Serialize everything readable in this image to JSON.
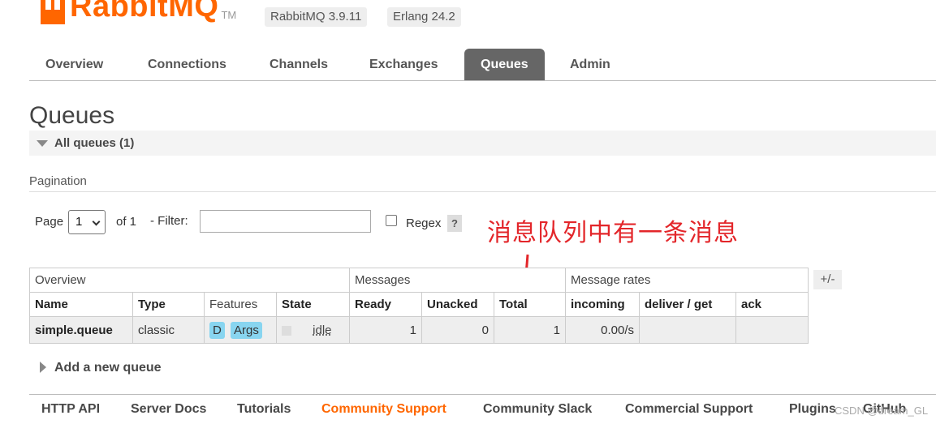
{
  "header": {
    "logo_text": "RabbitMQ",
    "logo_tm": "TM",
    "version": "RabbitMQ 3.9.11",
    "erlang": "Erlang 24.2"
  },
  "tabs": [
    {
      "label": "Overview"
    },
    {
      "label": "Connections"
    },
    {
      "label": "Channels"
    },
    {
      "label": "Exchanges"
    },
    {
      "label": "Queues",
      "active": true
    },
    {
      "label": "Admin"
    }
  ],
  "page": {
    "title": "Queues",
    "section_title": "All queues (1)",
    "pagination_label": "Pagination"
  },
  "pagination": {
    "page_label": "Page",
    "page_value": "1",
    "of_label": "of 1",
    "filter_label": "- Filter:",
    "filter_value": "",
    "regex_label": "Regex",
    "help_label": "?"
  },
  "annotation": "消息队列中有一条消息",
  "table": {
    "groups": [
      "Overview",
      "Messages",
      "Message rates"
    ],
    "columns": [
      "Name",
      "Type",
      "Features",
      "State",
      "Ready",
      "Unacked",
      "Total",
      "incoming",
      "deliver / get",
      "ack"
    ],
    "row": {
      "name": "simple.queue",
      "type": "classic",
      "features": [
        "D",
        "Args"
      ],
      "state": "idle",
      "ready": "1",
      "unacked": "0",
      "total": "1",
      "incoming": "0.00/s",
      "deliver_get": "",
      "ack": ""
    },
    "toggle_label": "+/-"
  },
  "add_queue_label": "Add a new queue",
  "footer": {
    "links": [
      "HTTP API",
      "Server Docs",
      "Tutorials",
      "Community Support",
      "Community Slack",
      "Commercial Support",
      "Plugins",
      "GitHub"
    ],
    "watermark": "CSDN @dream_GL"
  },
  "colors": {
    "brand": "#ff6600",
    "active_tab": "#666666",
    "feature_badge": "#88d5f0",
    "annotation": "#e3262a"
  }
}
